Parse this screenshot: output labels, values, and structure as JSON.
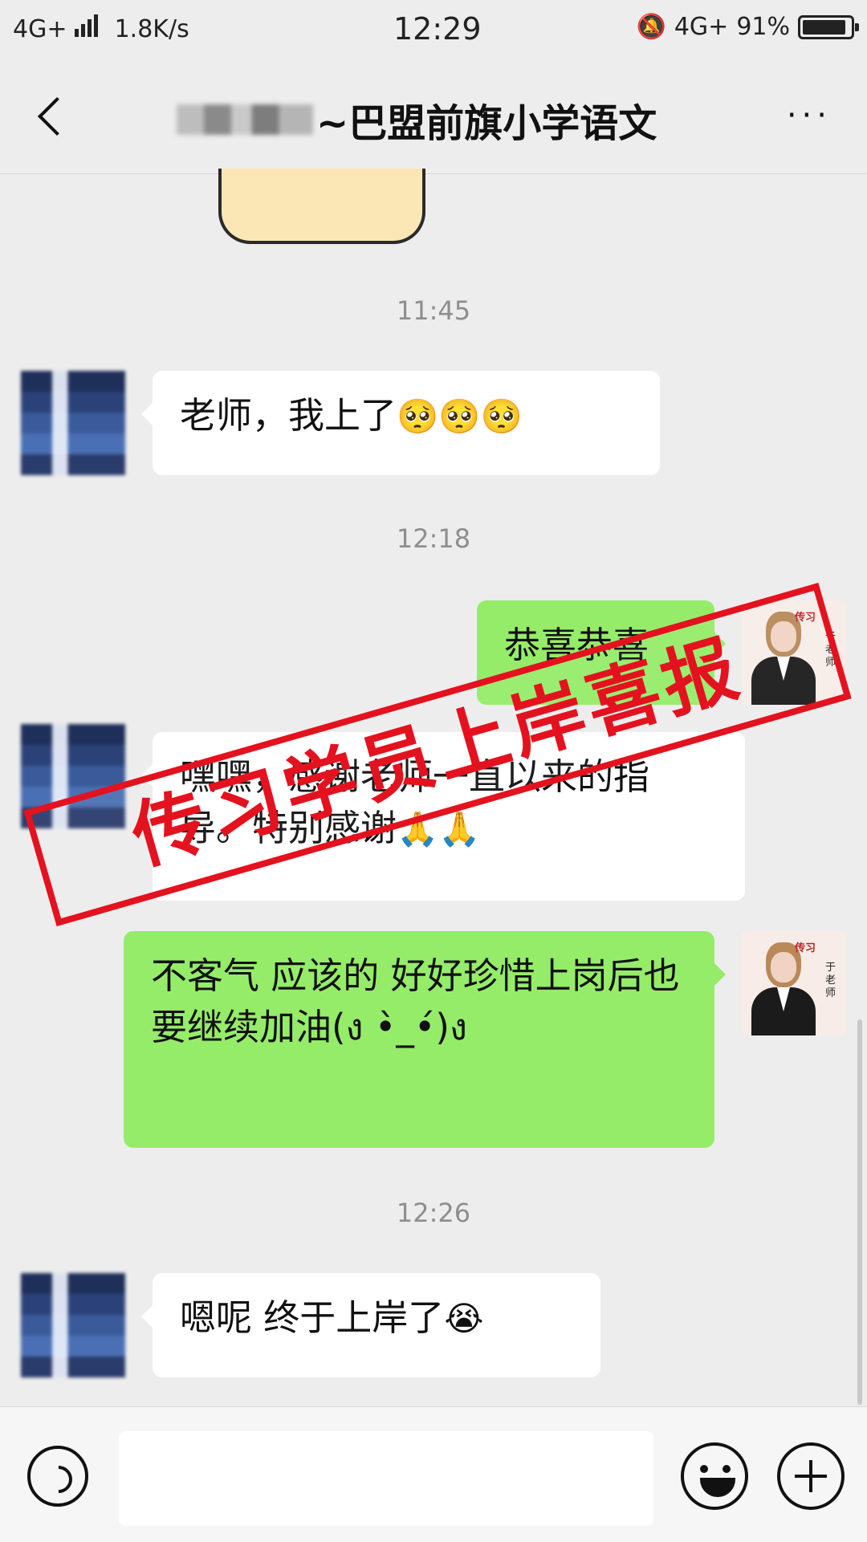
{
  "status_bar": {
    "network": "4G+",
    "speed": "1.8K/s",
    "time": "12:29",
    "right_network": "4G+",
    "battery": "91%",
    "battery_level": 0.91
  },
  "header": {
    "title_suffix": "~巴盟前旗小学语文",
    "more": "···"
  },
  "timestamps": [
    "11:45",
    "12:18",
    "12:26"
  ],
  "messages": [
    {
      "side": "in",
      "text": "老师，我上了",
      "emoji": "🥺🥺🥺"
    },
    {
      "side": "out",
      "text": "恭喜恭喜"
    },
    {
      "side": "in",
      "text": "嘿嘿，感谢老师一直以来的指导。特别感谢",
      "emoji": "🙏🙏"
    },
    {
      "side": "out",
      "text": "不客气 应该的 好好珍惜上岗后也要继续加油(ง •̀_•́)ง"
    },
    {
      "side": "in",
      "text": "嗯呢 终于上岸了",
      "emoji": "😭"
    }
  ],
  "teacher_avatar": {
    "brand": "传习",
    "name": "于老师"
  },
  "stamp": {
    "text": "传习学员上岸喜报",
    "color": "#e4121f"
  },
  "colors": {
    "out_bubble": "#95ec69",
    "in_bubble": "#ffffff",
    "background": "#ededed"
  },
  "icons": [
    "back-icon",
    "more-icon",
    "voice-icon",
    "emoji-icon",
    "plus-icon"
  ]
}
